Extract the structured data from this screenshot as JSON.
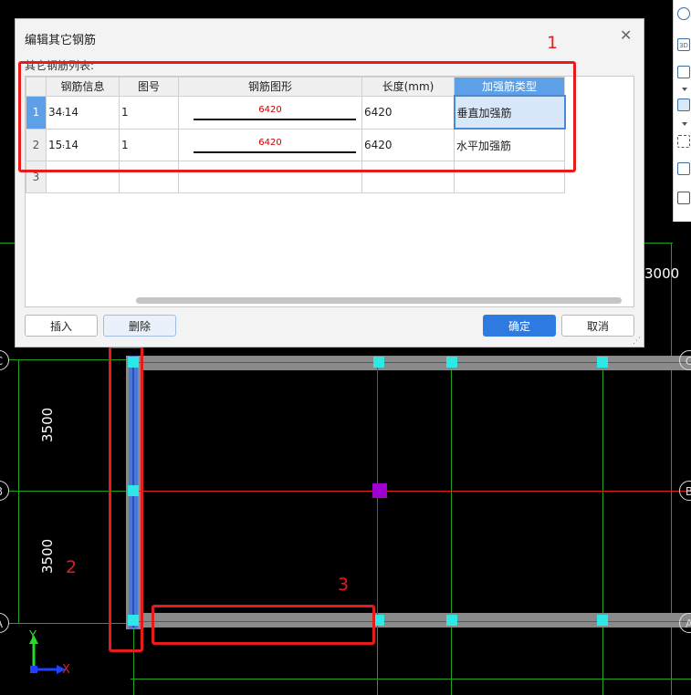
{
  "dialog": {
    "title": "编辑其它钢筋",
    "list_label": "其它钢筋列表:",
    "columns": [
      "",
      "钢筋信息",
      "图号",
      "钢筋图形",
      "长度(mm)",
      "加强筋类型"
    ],
    "rows": [
      {
        "num": "1",
        "info_count": "34",
        "info_sym": "⹎",
        "info_dia": "14",
        "figure_no": "1",
        "shape_label": "6420",
        "length": "6420",
        "type": "垂直加强筋"
      },
      {
        "num": "2",
        "info_count": "15",
        "info_sym": "⹎",
        "info_dia": "14",
        "figure_no": "1",
        "shape_label": "6420",
        "length": "6420",
        "type": "水平加强筋"
      },
      {
        "num": "3",
        "info_count": "",
        "info_sym": "",
        "info_dia": "",
        "figure_no": "",
        "shape_label": "",
        "length": "",
        "type": ""
      }
    ],
    "buttons": {
      "insert": "插入",
      "delete": "删除",
      "ok": "确定",
      "cancel": "取消"
    }
  },
  "toolbar": {
    "icons": [
      "circle-icon",
      "3d-view-icon",
      "box-icon",
      "chevron-down-icon",
      "box-active-icon",
      "chevron-down-icon",
      "dashed-select-icon",
      "cube-icon",
      "list-icon"
    ],
    "label_3d": "3D"
  },
  "cad": {
    "dims": {
      "upper": "3500",
      "lower": "3500",
      "right_top": "3000"
    },
    "axes": {
      "C": "C",
      "B": "B",
      "A": "A"
    },
    "annotations": {
      "one": "1",
      "two": "2",
      "three": "3"
    },
    "ucs": {
      "x": "X",
      "y": "Y"
    }
  },
  "colors": {
    "accent": "#2d7be0",
    "annotation_red": "#e61c1c",
    "grid_green": "#1fa01f",
    "column_cyan": "#2ee8e8",
    "highlight_purple": "#a000d0"
  }
}
